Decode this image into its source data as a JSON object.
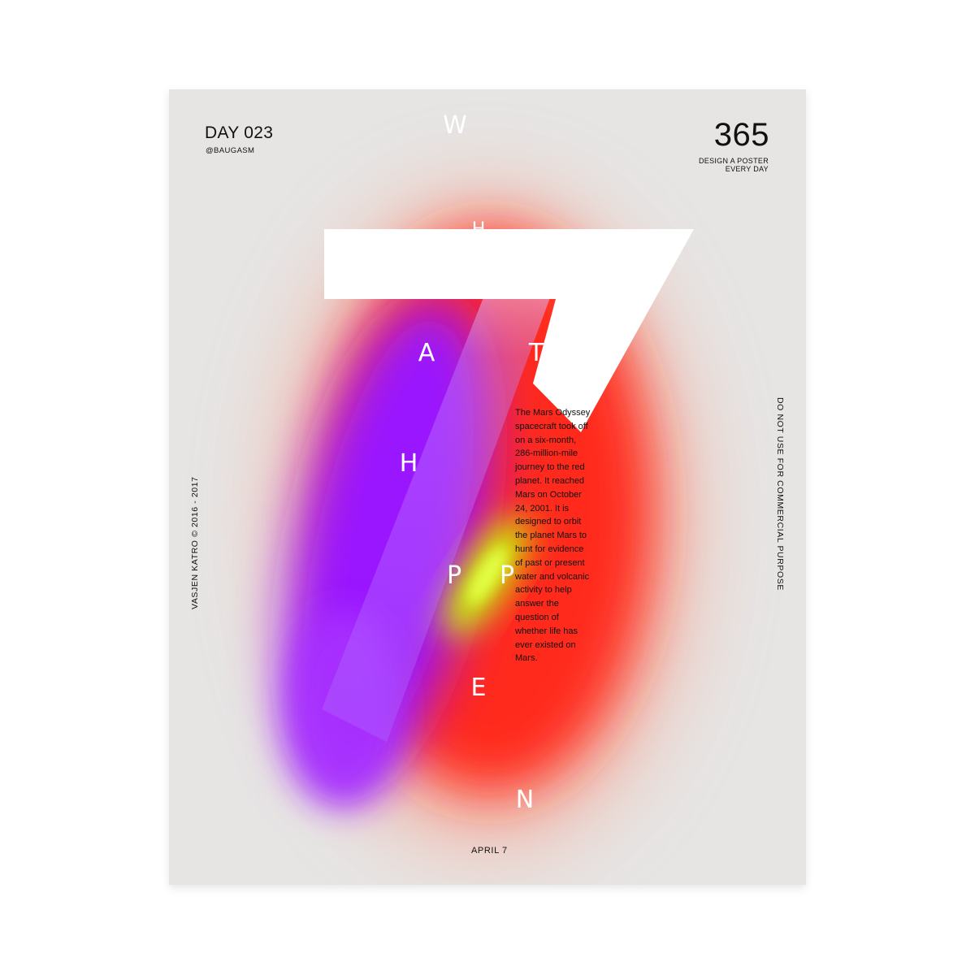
{
  "poster": {
    "day_label": "DAY 023",
    "handle": "@BAUGASM",
    "series_number": "365",
    "series_tagline": [
      "DESIGN A POSTER",
      "EVERY DAY"
    ],
    "author_credit": "VASJEN KATRO © 2016 - 2017",
    "usage_note": "DO NOT USE FOR COMMERCIAL PURPOSE",
    "date": "APRIL 7",
    "big_numeral": "7",
    "headline_letters": [
      "W",
      "H",
      "A",
      "T",
      "H",
      "P",
      "P",
      "E",
      "N"
    ],
    "body_lines": [
      "The Mars Odyssey",
      "spacecraft took off",
      "on a six-month,",
      "286-million-mile",
      "journey to the red",
      "planet. It reached",
      "Mars on October",
      "24, 2001. It is",
      "designed to orbit",
      "the planet Mars to",
      "hunt for evidence",
      "of past or present",
      "water and volcanic",
      "activity to help",
      "answer the",
      "question of",
      "whether life has",
      "ever existed on",
      "Mars."
    ]
  },
  "colors": {
    "poster_background": "#e6e5e4",
    "red": "#ff2a1a",
    "purple": "#9a18ff",
    "lime": "#c8ff00",
    "numeral": "#ffffff",
    "ink": "#111111"
  }
}
